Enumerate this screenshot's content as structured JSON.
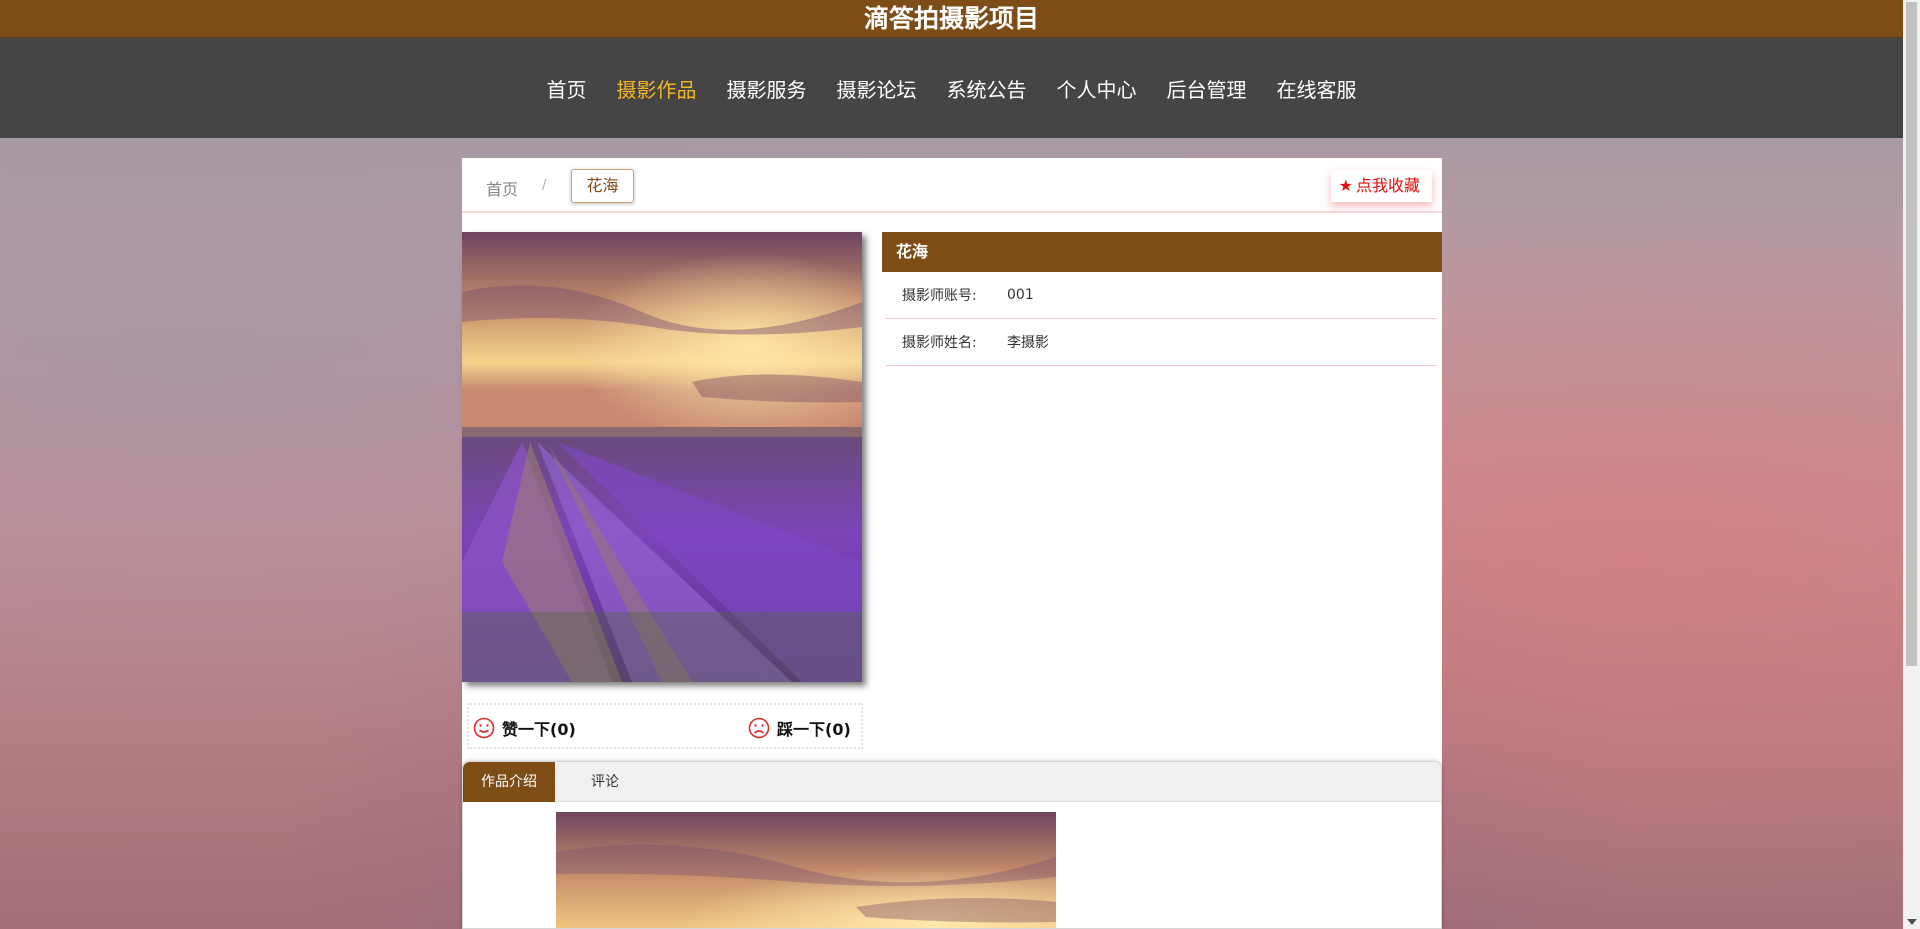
{
  "site": {
    "title": "滴答拍摄影项目"
  },
  "nav": {
    "items": [
      {
        "label": "首页"
      },
      {
        "label": "摄影作品",
        "active": true
      },
      {
        "label": "摄影服务"
      },
      {
        "label": "摄影论坛"
      },
      {
        "label": "系统公告"
      },
      {
        "label": "个人中心"
      },
      {
        "label": "后台管理"
      },
      {
        "label": "在线客服"
      }
    ],
    "active_color": "#f5b625"
  },
  "breadcrumb": {
    "home": "首页",
    "separator": "/",
    "current": "花海"
  },
  "favorite": {
    "label": "点我收藏",
    "icon": "star-icon",
    "color": "#e30f0f"
  },
  "work": {
    "title": "花海",
    "fields": [
      {
        "label": "摄影师账号:",
        "value": "001"
      },
      {
        "label": "摄影师姓名:",
        "value": "李摄影"
      }
    ]
  },
  "votes": {
    "like_label": "赞一下(0)",
    "like_icon": "smile-icon",
    "dislike_label": "踩一下(0)",
    "dislike_icon": "frown-icon"
  },
  "tabs": [
    {
      "label": "作品介绍",
      "active": true
    },
    {
      "label": "评论"
    }
  ],
  "theme": {
    "brand": "#7d4c17",
    "nav_bg": "#454545"
  }
}
